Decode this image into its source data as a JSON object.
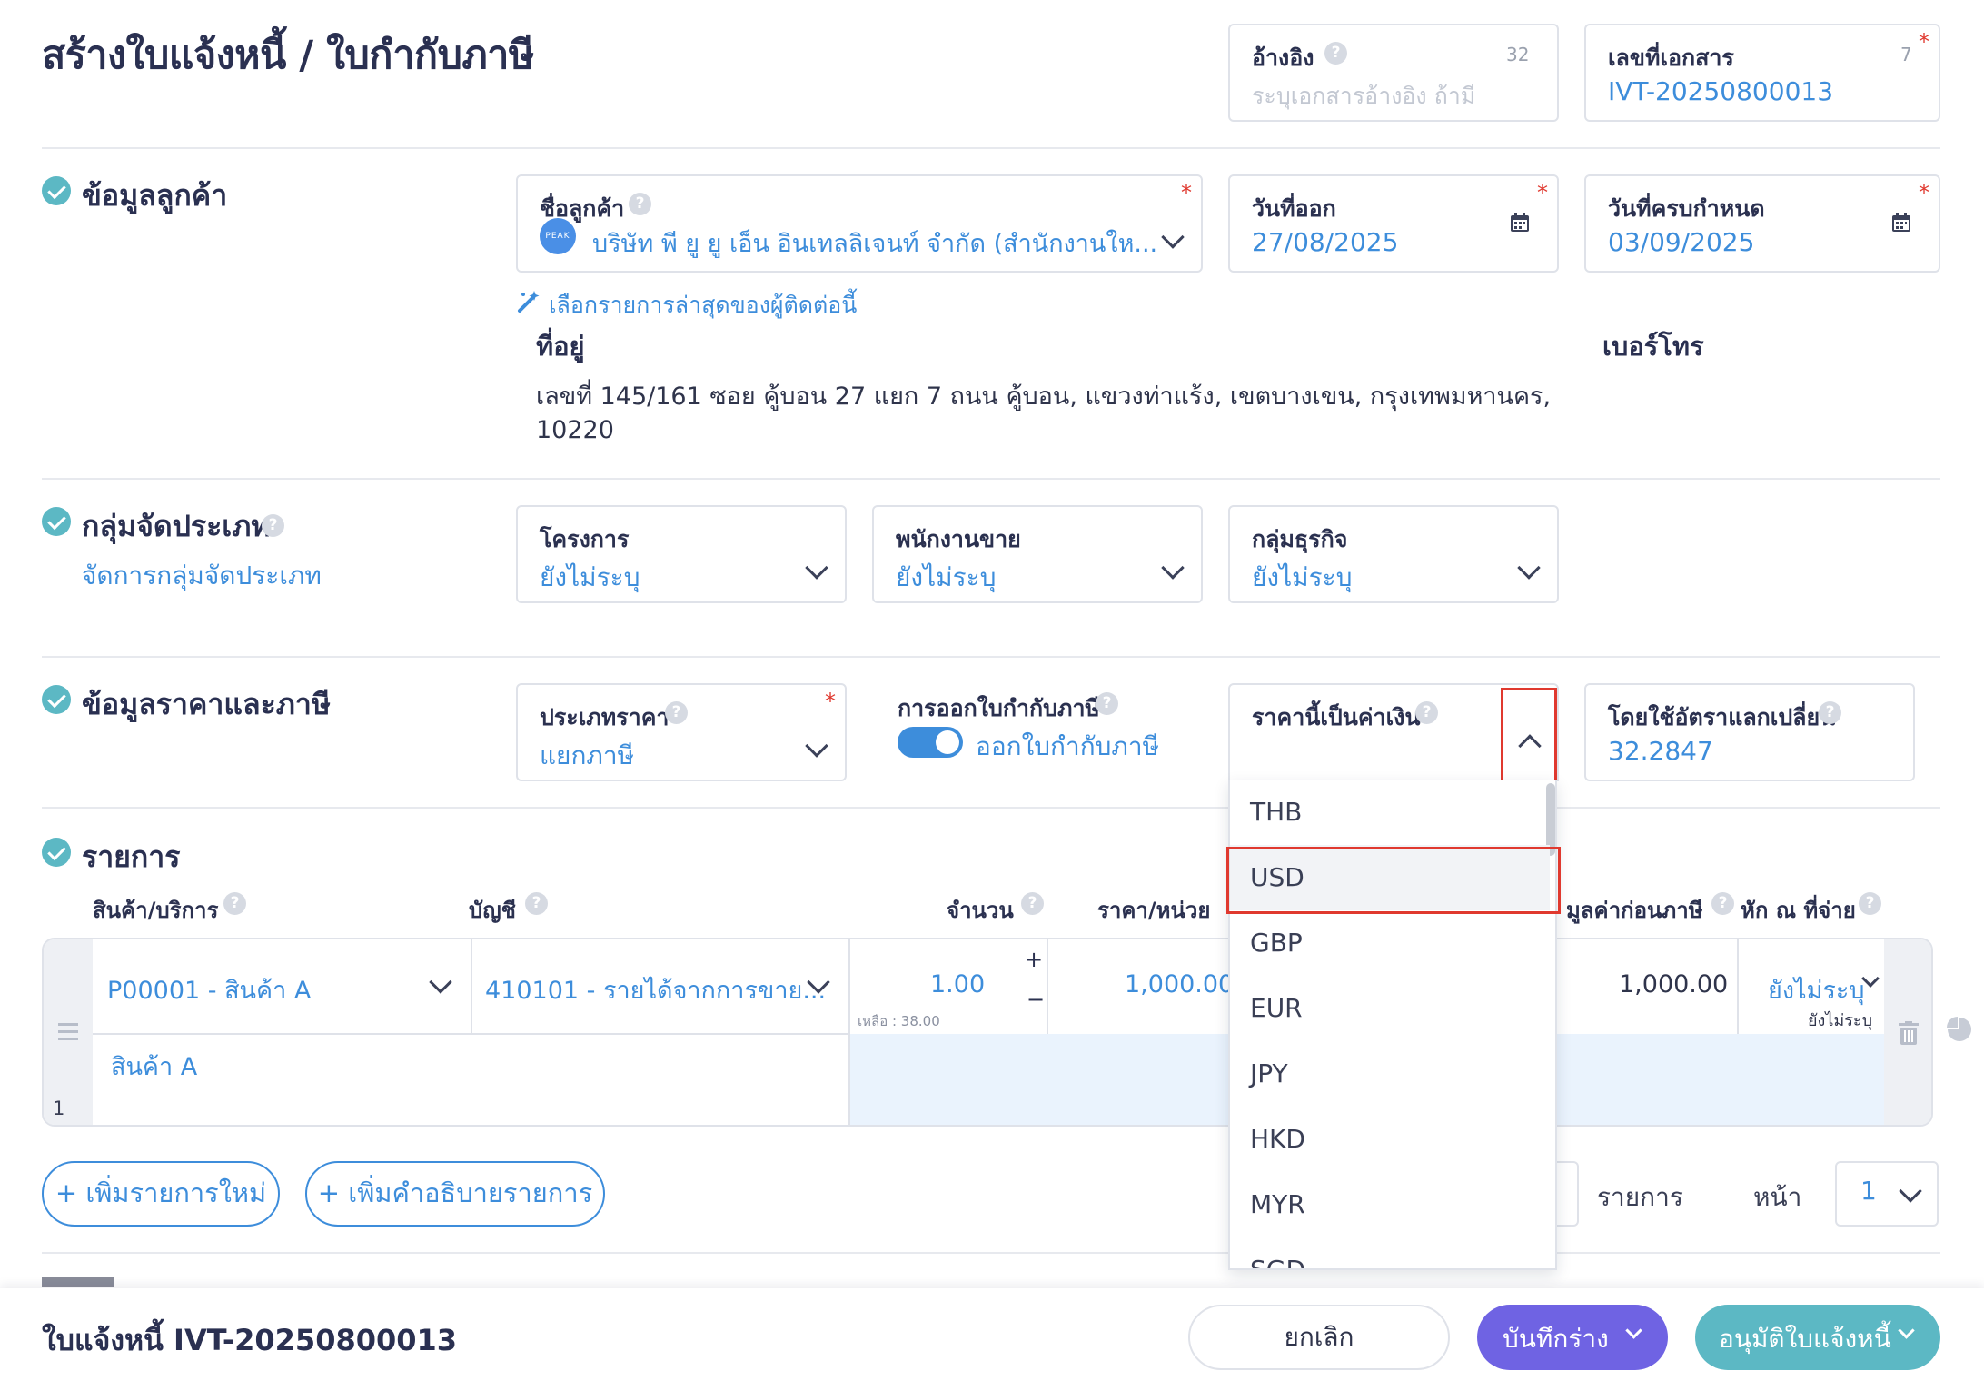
{
  "page": {
    "title": "สร้างใบแจ้งหนี้ / ใบกำกับภาษี",
    "reference": {
      "label": "อ้างอิง",
      "placeholder": "ระบุเอกสารอ้างอิง ถ้ามี",
      "counter": "32"
    },
    "doc_number": {
      "label": "เลขที่เอกสาร",
      "value": "IVT-20250800013",
      "counter": "7"
    }
  },
  "customer_section": {
    "heading": "ข้อมูลลูกค้า",
    "customer": {
      "label": "ชื่อลูกค้า",
      "value": "บริษัท พี ยู ยู เอ็น อินเทลลิเจนท์ จำกัด (สำนักงานให...",
      "logo": "PEAK"
    },
    "issue_date": {
      "label": "วันที่ออก",
      "value": "27/08/2025"
    },
    "due_date": {
      "label": "วันที่ครบกำหนด",
      "value": "03/09/2025"
    },
    "recent_link": "เลือกรายการล่าสุดของผู้ติดต่อนี้",
    "address_label": "ที่อยู่",
    "address_line1": "เลขที่ 145/161 ซอย คู้บอน 27 แยก 7 ถนน คู้บอน, แขวงท่าแร้ง, เขตบางเขน, กรุงเทพมหานคร,",
    "address_line2": "10220",
    "phone_label": "เบอร์โทร"
  },
  "group_section": {
    "heading": "กลุ่มจัดประเภท",
    "manage_link": "จัดการกลุ่มจัดประเภท",
    "project": {
      "label": "โครงการ",
      "value": "ยังไม่ระบุ"
    },
    "salesperson": {
      "label": "พนักงานขาย",
      "value": "ยังไม่ระบุ"
    },
    "business_group": {
      "label": "กลุ่มธุรกิจ",
      "value": "ยังไม่ระบุ"
    }
  },
  "price_section": {
    "heading": "ข้อมูลราคาและภาษี",
    "price_type": {
      "label": "ประเภทราคา",
      "value": "แยกภาษี"
    },
    "tax_invoice": {
      "label": "การออกใบกำกับภาษี",
      "toggle_label": "ออกใบกำกับภาษี",
      "on": true
    },
    "currency": {
      "label": "ราคานี้เป็นค่าเงิน",
      "options": [
        "THB",
        "USD",
        "GBP",
        "EUR",
        "JPY",
        "HKD",
        "MYR",
        "SGD"
      ],
      "highlighted": "USD"
    },
    "exchange_rate": {
      "label": "โดยใช้อัตราแลกเปลี่ยน",
      "value": "32.2847"
    }
  },
  "items_section": {
    "heading": "รายการ",
    "columns": {
      "product": "สินค้า/บริการ",
      "account": "บัญชี",
      "qty": "จำนวน",
      "unit_price": "ราคา/หน่วย",
      "pre_tax": "มูลค่าก่อนภาษี",
      "withholding": "หัก ณ ที่จ่าย"
    },
    "row": {
      "product": "P00001 - สินค้า A",
      "account": "410101 - รายได้จากการขาย...",
      "qty": "1.00",
      "remaining": "เหลือ : 38.00",
      "unit_price": "1,000.00",
      "pre_tax": "1,000.00",
      "withholding": "ยังไม่ระบุ",
      "withholding_sub": "ยังไม่ระบุ",
      "description": "สินค้า A",
      "index": "1"
    },
    "add_item": "+ เพิ่มรายการใหม่",
    "add_description": "+ เพิ่มคำอธิบายรายการ",
    "items_label": "รายการ",
    "page_label": "หน้า",
    "page_value": "1"
  },
  "footer": {
    "doc_title": "ใบแจ้งหนี้ IVT-20250800013",
    "cancel": "ยกเลิก",
    "save_draft": "บันทึกร่าง",
    "approve": "อนุมัติใบแจ้งหนี้"
  },
  "colors": {
    "accent_blue": "#3d8ddb",
    "teal": "#5cb8c4",
    "purple": "#6f63e3",
    "highlight_red": "#e0392f"
  }
}
